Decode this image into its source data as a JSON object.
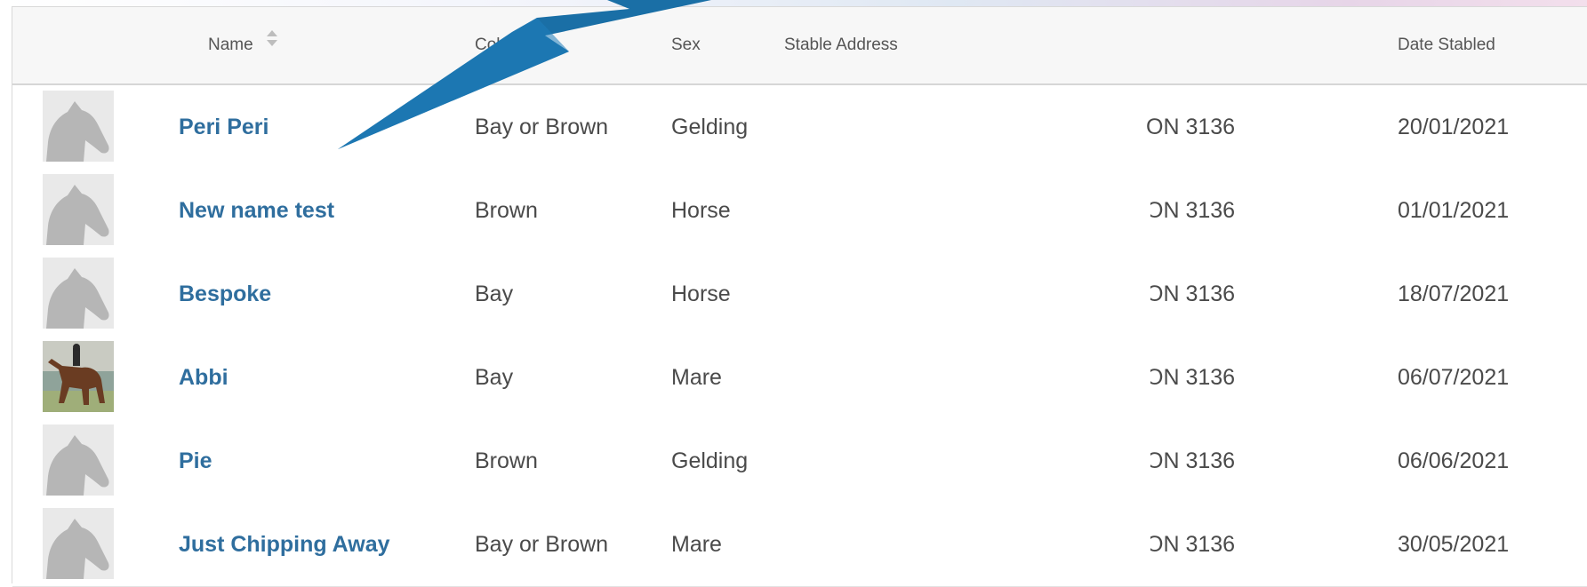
{
  "table": {
    "headers": {
      "name": "Name",
      "colour": "Colour",
      "sex": "Sex",
      "stable_address": "Stable Address",
      "date_stabled": "Date Stabled"
    },
    "rows": [
      {
        "name": "Peri Peri",
        "colour": "Bay or Brown",
        "sex": "Gelding",
        "address": "ON 3136",
        "date": "20/01/2021",
        "thumb": "horse-silhouette-icon"
      },
      {
        "name": "New name test",
        "colour": "Brown",
        "sex": "Horse",
        "address": "ON 3136",
        "date": "01/01/2021",
        "thumb": "horse-silhouette-icon"
      },
      {
        "name": "Bespoke",
        "colour": "Bay",
        "sex": "Horse",
        "address": "ON 3136",
        "date": "18/07/2021",
        "thumb": "horse-silhouette-icon"
      },
      {
        "name": "Abbi",
        "colour": "Bay",
        "sex": "Mare",
        "address": "ON 3136",
        "date": "06/07/2021",
        "thumb": "horse-photo"
      },
      {
        "name": "Pie",
        "colour": "Brown",
        "sex": "Gelding",
        "address": "ON 3136",
        "date": "06/06/2021",
        "thumb": "horse-silhouette-icon"
      },
      {
        "name": "Just Chipping Away",
        "colour": "Bay or Brown",
        "sex": "Mare",
        "address": "ON 3136",
        "date": "30/05/2021",
        "thumb": "horse-silhouette-icon"
      }
    ]
  },
  "colors": {
    "link": "#2f6e9e",
    "arrow": "#1a6fa6",
    "header_bg": "#f7f7f7"
  }
}
